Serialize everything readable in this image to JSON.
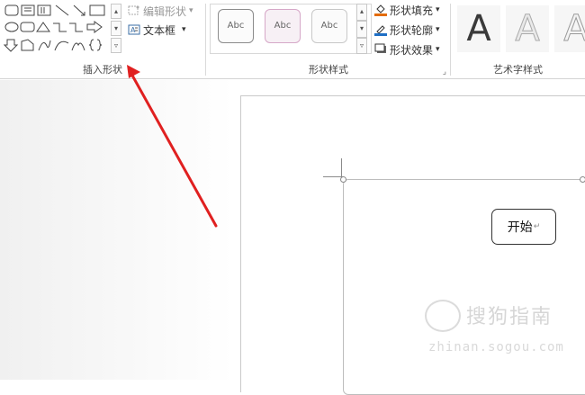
{
  "ribbon": {
    "insert_shapes": {
      "label": "插入形状",
      "edit_shape_label": "编辑形状",
      "edit_shape_arrow": "▾",
      "text_box_label": "文本框",
      "text_box_arrow": "▾"
    },
    "shape_styles": {
      "label": "形状样式",
      "presets": [
        "Abc",
        "Abc",
        "Abc"
      ],
      "fill_label": "形状填充",
      "outline_label": "形状轮廓",
      "effects_label": "形状效果",
      "dropdown_arrow": "▾",
      "launcher": "⌟"
    },
    "wordart": {
      "label": "艺术字样式",
      "presets": [
        "A",
        "A",
        "A"
      ]
    }
  },
  "document": {
    "textbox_text": "开始",
    "paragraph_mark": "↵"
  },
  "watermark": {
    "text": "搜狗指南",
    "sub": "zhinan.sogou.com"
  },
  "colors": {
    "arrow": "#e02020",
    "fill_accent": "#e36c09",
    "outline_accent": "#1f6fc5"
  }
}
